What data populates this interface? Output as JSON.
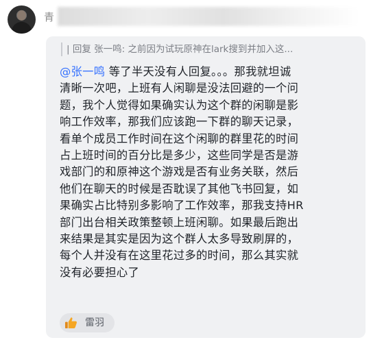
{
  "sender": {
    "name_visible": "青"
  },
  "message": {
    "quote": "| 回复 张一鸣: 之前因为试玩原神在lark搜到并加入这...",
    "mention": "@张一鸣",
    "lines": [
      " 等了半天没有人回复。。。那我就坦诚",
      "清晰一次吧，上班有人闲聊是没法回避的一个问",
      "题，我个人觉得如果确实认为这个群的闲聊是影",
      "响工作效率，那我们应该跑一下群的聊天记录，",
      "看单个成员工作时间在这个闲聊的群里花的时间",
      "占上班时间的百分比是多少，这些同学是否是游",
      "戏部门的和原神这个游戏是否有业务关联，然后",
      "他们在聊天的时候是否耽误了其他飞书回复，如",
      "果确实占比特别多影响了工作效率，那我支持HR",
      "部门出台相关政策整顿上班闲聊。如果最后跑出",
      "来结果是其实是因为这个群人太多导致刷屏的，",
      "每个人并没有在这里花过多的时间，那么其实就",
      "没有必要担心了"
    ]
  },
  "reaction": {
    "icon": "thumbs-up-icon",
    "reactor": "雷羽"
  },
  "colors": {
    "mention": "#3370ff",
    "bubble": "#f0f1f3",
    "thumb": "#f5a623"
  }
}
